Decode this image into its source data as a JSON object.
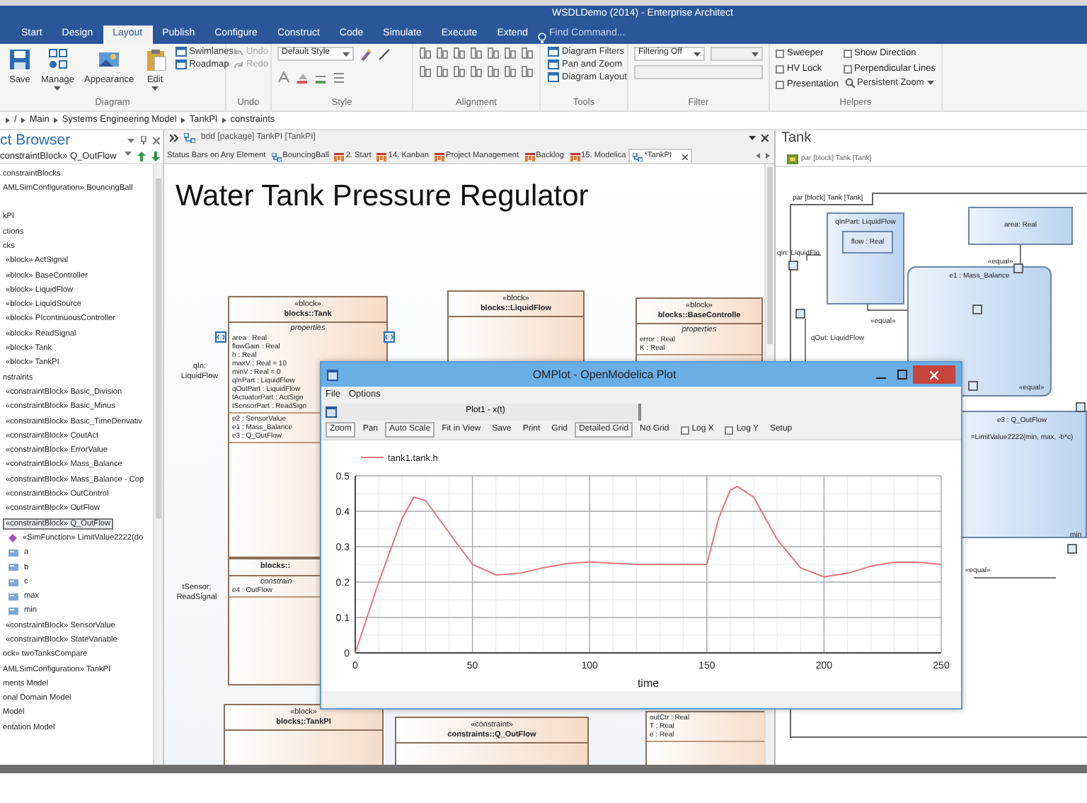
{
  "window": {
    "title": "WSDLDemo (2014) - Enterprise Architect"
  },
  "ribbon_tabs": [
    {
      "label": "Start",
      "selected": false
    },
    {
      "label": "Design",
      "selected": false
    },
    {
      "label": "Layout",
      "selected": true
    },
    {
      "label": "Publish",
      "selected": false
    },
    {
      "label": "Configure",
      "selected": false
    },
    {
      "label": "Construct",
      "selected": false
    },
    {
      "label": "Code",
      "selected": false
    },
    {
      "label": "Simulate",
      "selected": false
    },
    {
      "label": "Execute",
      "selected": false
    },
    {
      "label": "Extend",
      "selected": false
    }
  ],
  "find_command": {
    "placeholder": "Find Command..."
  },
  "ribbon_groups": [
    {
      "label": "Diagram",
      "items": [
        {
          "kind": "large",
          "label": "Save",
          "dropdown": false
        },
        {
          "kind": "large",
          "label": "Manage",
          "dropdown": true
        },
        {
          "kind": "large",
          "label": "Appearance",
          "dropdown": false
        },
        {
          "kind": "large",
          "label": "Edit",
          "dropdown": true
        },
        {
          "kind": "stack",
          "items": [
            {
              "label": "Swimlanes",
              "disabled": false
            },
            {
              "label": "Roadmap",
              "disabled": false
            }
          ]
        }
      ]
    },
    {
      "label": "Undo",
      "items": [
        {
          "kind": "history",
          "items": [
            {
              "label": "Undo",
              "disabled": true
            },
            {
              "label": "Redo",
              "disabled": true
            }
          ]
        }
      ]
    },
    {
      "label": "Style",
      "items": [
        {
          "kind": "style",
          "value": "Default Style"
        }
      ]
    },
    {
      "label": "Alignment",
      "items": [
        {
          "kind": "icons"
        }
      ]
    },
    {
      "label": "Tools",
      "items": [
        {
          "kind": "stack",
          "items": [
            {
              "label": "Diagram Filters",
              "disabled": false
            },
            {
              "label": "Pan and Zoom",
              "disabled": false
            },
            {
              "label": "Diagram Layout",
              "disabled": false
            }
          ]
        }
      ]
    },
    {
      "label": "Filter",
      "items": [
        {
          "kind": "filter",
          "value": "Filtering Off"
        }
      ]
    },
    {
      "label": "Helpers",
      "items": [
        {
          "kind": "checks",
          "items": [
            {
              "label": "Sweeper",
              "checked": false
            },
            {
              "label": "HV Lock",
              "checked": false
            },
            {
              "label": "Presentation",
              "checked": false
            }
          ]
        },
        {
          "kind": "checks",
          "items": [
            {
              "label": "Show Direction",
              "checked": false
            },
            {
              "label": "Perpendicular Lines",
              "checked": false
            }
          ],
          "menu": "Persistent Zoom"
        }
      ]
    }
  ],
  "breadcrumb": [
    "/",
    "Main",
    "Systems Engineering Model",
    "TankPI",
    "constraints"
  ],
  "browser": {
    "title": "ct Browser",
    "current": "constraintBlock» Q_OutFlow",
    "tree": [
      {
        "label": "constraintBlocks",
        "selected": false
      },
      {
        "label": "AMLSimConfiguration» BouncingBall",
        "selected": false
      },
      {
        "label": "kPI",
        "selected": false
      },
      {
        "label": "ctions",
        "selected": false
      },
      {
        "label": "cks",
        "selected": false,
        "children": [
          {
            "label": "«block» ActSignal",
            "selected": false
          },
          {
            "label": "«block» BaseController",
            "selected": false
          },
          {
            "label": "«block» LiquidFlow",
            "selected": false
          },
          {
            "label": "«block» LiquidSource",
            "selected": false
          },
          {
            "label": "«block» PIcontinuousController",
            "selected": false
          },
          {
            "label": "«block» ReadSignal",
            "selected": false
          },
          {
            "label": "«block» Tank",
            "selected": false
          },
          {
            "label": "«block» TankPI",
            "selected": false
          }
        ]
      },
      {
        "label": "nstraints",
        "selected": false,
        "children": [
          {
            "label": "«constraintBlock» Basic_Division",
            "selected": false
          },
          {
            "label": "«constraintBlock» Basic_Minus",
            "selected": false
          },
          {
            "label": "«constraintBlock» Basic_TimeDerivativ",
            "selected": false
          },
          {
            "label": "«constraintBlock» CoutAct",
            "selected": false
          },
          {
            "label": "«constraintBlock» ErrorValue",
            "selected": false
          },
          {
            "label": "«constraintBlock» Mass_Balance",
            "selected": false
          },
          {
            "label": "«constraintBlock» Mass_Balance - Cop",
            "selected": false
          },
          {
            "label": "«constraintBlock» OutControl",
            "selected": false
          },
          {
            "label": "«constraintBlock» OutFlow",
            "selected": false
          },
          {
            "label": "«constraintBlock» Q_OutFlow",
            "selected": true,
            "children": [
              {
                "label": "«SimFunction» LimitValue2222(do",
                "kind": "operation",
                "selected": false
              },
              {
                "label": "a",
                "kind": "attribute",
                "selected": false
              },
              {
                "label": "b",
                "kind": "attribute",
                "selected": false
              },
              {
                "label": "c",
                "kind": "attribute",
                "selected": false
              },
              {
                "label": "max",
                "kind": "attribute",
                "selected": false
              },
              {
                "label": "min",
                "kind": "attribute",
                "selected": false
              }
            ]
          },
          {
            "label": "«constraintBlock» SensorValue",
            "selected": false
          },
          {
            "label": "«constraintBlock» StateVariable",
            "selected": false
          }
        ]
      },
      {
        "label": "ock» twoTanksCompare",
        "selected": false
      },
      {
        "label": "AMLSimConfiguration» TankPI",
        "selected": false
      },
      {
        "label": "ments Model",
        "selected": false
      },
      {
        "label": "onal Domain Model",
        "selected": false
      },
      {
        "label": "Model",
        "selected": false
      },
      {
        "label": "entation Model",
        "selected": false
      }
    ]
  },
  "diagram": {
    "header": "bdd [package] TankPI [TankPI]",
    "tabs": [
      {
        "label": "Status Bars on Any Element",
        "kind": "plain",
        "selected": false
      },
      {
        "label": "BouncingBall",
        "kind": "sysml",
        "selected": false
      },
      {
        "label": "2. Start",
        "kind": "kanban",
        "selected": false
      },
      {
        "label": "14. Kanban",
        "kind": "kanban",
        "selected": false
      },
      {
        "label": "Project Management",
        "kind": "kanban",
        "selected": false
      },
      {
        "label": "Backlog",
        "kind": "kanban",
        "selected": false
      },
      {
        "label": "15. Modelica",
        "kind": "kanban",
        "selected": false
      },
      {
        "label": "*TankPI",
        "kind": "sysml",
        "selected": true
      }
    ],
    "title": "Water Tank Pressure Regulator",
    "blocks": [
      {
        "stereotype": "«block»",
        "name": "blocks::Tank",
        "compartments": [
          {
            "label": "properties",
            "lines": [
              "area : Real",
              "flowGain : Real",
              "h : Real",
              "maxV : Real = 10",
              "minV : Real = 0",
              "qInPart : LiquidFlow",
              "qOutPart : LiquidFlow",
              "tActuatorPart : ActSign",
              "tSensorPart : ReadSign"
            ]
          },
          {
            "lines": [
              "e2 : SensorValue",
              "e1 : Mass_Balance",
              "e3 : Q_OutFlow"
            ]
          }
        ]
      },
      {
        "stereotype": "«block»",
        "name": "blocks::LiquidFlow"
      },
      {
        "stereotype": "«block»",
        "name": "blocks::BaseControlle",
        "compartments": [
          {
            "label": "properties",
            "lines": [
              "error : Real",
              "K : Real"
            ]
          }
        ]
      },
      {
        "name": "blocks::",
        "compartments": [
          {
            "label": "constrain",
            "lines": [
              "e4 : OutFlow"
            ]
          }
        ]
      },
      {
        "stereotype": "«block»",
        "name": "blocks::TankPI"
      },
      {
        "stereotype": "«constraint»",
        "name": "constraints::Q_OutFlow"
      },
      {
        "compartments": [
          {
            "lines": [
              "outCtr : Real",
              "T : Real",
              "e : Real"
            ]
          }
        ]
      }
    ],
    "port_labels": [
      "qIn: LiquidFlow",
      "tSensor: ReadSignal"
    ]
  },
  "side_diagram": {
    "title": "Tank",
    "header": "par [block] Tank [Tank]",
    "frame_label": "par [block] Tank [Tank]",
    "parts": [
      {
        "name": "qInPart: LiquidFlow",
        "inner": "flow : Real"
      },
      {
        "name": "area: Real"
      },
      {
        "name": "e1 : Mass_Balance"
      },
      {
        "name": "e3 : Q_OutFlow",
        "inner": "=LimitValue2222(min, max, -b*c)"
      }
    ],
    "labels": [
      "qIn: LiquidFlo",
      "qOut: LiquidFlow",
      "«equal»",
      "«equal»",
      "«equal»",
      "«equal»",
      "min"
    ]
  },
  "plot_window": {
    "title": "OMPlot - OpenModelica Plot",
    "menu": [
      "File",
      "Options"
    ],
    "tab": "Plot1 - x(t)",
    "toolbar": [
      {
        "label": "Zoom",
        "kind": "button",
        "pressed": true
      },
      {
        "label": "Pan",
        "kind": "button",
        "pressed": false
      },
      {
        "label": "Auto Scale",
        "kind": "button",
        "pressed": true
      },
      {
        "label": "Fit in View",
        "kind": "button",
        "pressed": false
      },
      {
        "label": "Save",
        "kind": "button",
        "pressed": false
      },
      {
        "label": "Print",
        "kind": "button",
        "pressed": false
      },
      {
        "label": "Grid",
        "kind": "button",
        "pressed": false
      },
      {
        "label": "Detailed Grid",
        "kind": "button",
        "pressed": true
      },
      {
        "label": "No Grid",
        "kind": "button",
        "pressed": false
      },
      {
        "label": "Log X",
        "kind": "check",
        "checked": false
      },
      {
        "label": "Log Y",
        "kind": "check",
        "checked": false
      },
      {
        "label": "Setup",
        "kind": "button",
        "pressed": false
      }
    ],
    "chart_data": {
      "type": "line",
      "xlabel": "time",
      "x": [
        0,
        10,
        20,
        25,
        30,
        40,
        50,
        60,
        70,
        80,
        90,
        100,
        110,
        120,
        130,
        140,
        150,
        155,
        160,
        163,
        170,
        180,
        190,
        200,
        210,
        220,
        230,
        240,
        250
      ],
      "series": [
        {
          "name": "tank1.tank.h",
          "color": "#e8767c",
          "values": [
            0,
            0.2,
            0.38,
            0.44,
            0.43,
            0.34,
            0.25,
            0.22,
            0.225,
            0.24,
            0.252,
            0.257,
            0.253,
            0.25,
            0.25,
            0.25,
            0.25,
            0.38,
            0.46,
            0.47,
            0.44,
            0.32,
            0.24,
            0.215,
            0.225,
            0.245,
            0.256,
            0.256,
            0.25
          ]
        }
      ],
      "grid": true,
      "xlim": [
        0,
        250
      ],
      "ylim": [
        0,
        0.5
      ],
      "xticks": [
        0,
        50,
        100,
        150,
        200,
        250
      ],
      "yticks": [
        0,
        0.1,
        0.2,
        0.3,
        0.4,
        0.5
      ]
    }
  }
}
